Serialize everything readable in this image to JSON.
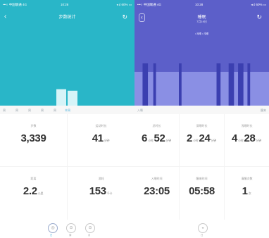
{
  "left": {
    "status_bar": {
      "carrier": "•••○ 中国联通 4G",
      "time": "10:28",
      "battery": "◂ ♯ 60% ▭"
    },
    "nav": {
      "back_icon": "chevron-left-icon",
      "title": "步数统计",
      "refresh_icon": "refresh-icon"
    },
    "colors": {
      "header": "#29b6c8",
      "bars": "#d6f4f8"
    },
    "bar_values": [
      0.22,
      0.2
    ],
    "axis_labels": [
      "周",
      "周",
      "周",
      "周",
      "周",
      "本周"
    ],
    "stats": [
      {
        "label": "步数",
        "value": "3,339",
        "unit": ""
      },
      {
        "label": "运动时长",
        "value": "41",
        "unit": "分钟"
      },
      {
        "label": "距离",
        "value": "2.2",
        "unit": "公里"
      },
      {
        "label": "消耗",
        "value": "153",
        "unit": "千卡"
      }
    ],
    "bottom_tabs": [
      {
        "label": "日",
        "icon": "day-icon",
        "active": true
      },
      {
        "label": "周",
        "icon": "week-icon",
        "active": false
      },
      {
        "label": "月",
        "icon": "month-icon",
        "active": false
      }
    ]
  },
  "right": {
    "status_bar": {
      "carrier": "•••○ 中国联通 4G",
      "time": "10:28",
      "battery": "◂ ♯ 60% ▭"
    },
    "nav": {
      "back_icon": "chevron-left-icon",
      "title": "睡眠",
      "subtitle": "7月19日",
      "refresh_icon": "refresh-icon",
      "chart_note": "• 深睡 • 浅睡"
    },
    "colors": {
      "header": "#5c5fc9",
      "deep": "#3b3fb0",
      "light": "#8a8fe4"
    },
    "sleep_segments": [
      {
        "type": "light",
        "start": 0.0,
        "end": 0.06
      },
      {
        "type": "deep",
        "start": 0.06,
        "end": 0.1
      },
      {
        "type": "light",
        "start": 0.1,
        "end": 0.14
      },
      {
        "type": "deep",
        "start": 0.14,
        "end": 0.16
      },
      {
        "type": "light",
        "start": 0.16,
        "end": 0.33
      },
      {
        "type": "deep",
        "start": 0.33,
        "end": 0.35
      },
      {
        "type": "light",
        "start": 0.35,
        "end": 0.61
      },
      {
        "type": "deep",
        "start": 0.61,
        "end": 0.64
      },
      {
        "type": "light",
        "start": 0.64,
        "end": 0.7
      },
      {
        "type": "deep",
        "start": 0.7,
        "end": 0.74
      },
      {
        "type": "light",
        "start": 0.74,
        "end": 0.77
      },
      {
        "type": "deep",
        "start": 0.77,
        "end": 0.81
      },
      {
        "type": "light",
        "start": 0.81,
        "end": 0.84
      },
      {
        "type": "deep",
        "start": 0.84,
        "end": 0.86
      },
      {
        "type": "light",
        "start": 0.86,
        "end": 1.0
      }
    ],
    "axis_start": "入睡",
    "axis_end": "醒来",
    "stats": [
      {
        "label": "总时长",
        "h": "6",
        "m": "52",
        "time": ""
      },
      {
        "label": "深睡时长",
        "h": "2",
        "m": "24",
        "time": ""
      },
      {
        "label": "浅睡时长",
        "h": "4",
        "m": "28",
        "time": ""
      },
      {
        "label": "入睡时间",
        "h": "",
        "m": "",
        "time": "23:05"
      },
      {
        "label": "醒来时间",
        "h": "",
        "m": "",
        "time": "05:58"
      },
      {
        "label": "清醒次数",
        "h": "",
        "m": "",
        "time": "1"
      }
    ],
    "units": {
      "hour": "小时",
      "minute": "分钟",
      "times": "次"
    },
    "bottom_tabs": [
      {
        "label": "日",
        "icon": "day-icon",
        "active": true
      }
    ]
  }
}
